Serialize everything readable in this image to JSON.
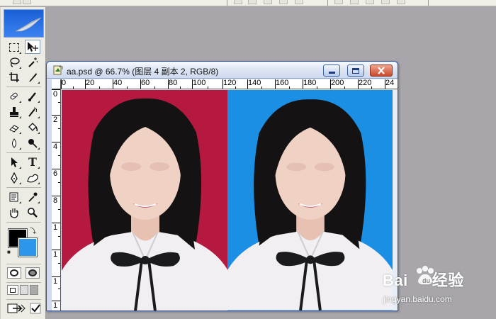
{
  "document": {
    "title": "aa.psd @ 66.7% (图层 4 副本 2, RGB/8)"
  },
  "ruler": {
    "top_labels": [
      "0",
      "20",
      "40",
      "60",
      "80",
      "100",
      "120",
      "140",
      "160",
      "180",
      "200",
      "220",
      "24"
    ],
    "left_labels": [
      "0",
      "2",
      "4",
      "6",
      "8",
      "1",
      "1",
      "1",
      "1"
    ]
  },
  "canvas": {
    "left_background": "#b5193f",
    "right_background": "#1b8fe4"
  },
  "toolbox": {
    "foreground_color": "#000000",
    "background_color": "#2c97ea"
  },
  "watermark": {
    "logo_left": "Bai",
    "logo_right": "经验",
    "url": "jingyan.baidu.com"
  }
}
